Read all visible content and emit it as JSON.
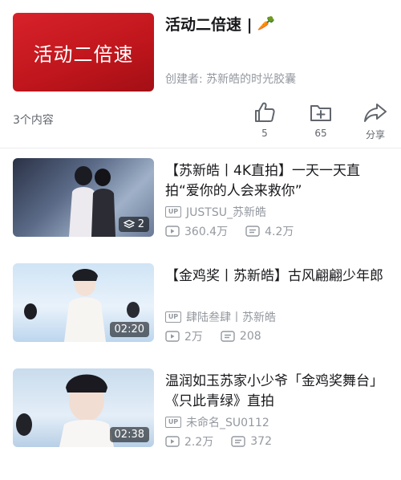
{
  "collection": {
    "cover_text": "活动二倍速",
    "title": "活动二倍速 |",
    "title_emoji": "🥕",
    "creator": "创建者: 苏新皓的时光胶囊",
    "item_count": "3个内容"
  },
  "actions": [
    {
      "label": "5",
      "icon": "thumbs-up-icon"
    },
    {
      "label": "65",
      "icon": "folder-add-icon"
    },
    {
      "label": "分享",
      "icon": "share-icon"
    }
  ],
  "videos": [
    {
      "title": "【苏新皓丨4K直拍】一天一天直拍“爱你的人会来救你”",
      "uploader": "JUSTSU_苏新皓",
      "views": "360.4万",
      "comments": "4.2万",
      "badge": "2",
      "badge_icon": "layers-icon"
    },
    {
      "title": "【金鸡奖丨苏新皓】古风翩翩少年郎",
      "uploader": "肆陆叁肆丨苏新皓",
      "views": "2万",
      "comments": "208",
      "badge": "02:20"
    },
    {
      "title": "温润如玉苏家小少爷「金鸡奖舞台」《只此青绿》直拍",
      "uploader": "未命名_SU0112",
      "views": "2.2万",
      "comments": "372",
      "badge": "02:38"
    }
  ],
  "colors": {
    "accent_red": "#d8222a",
    "meta_gray": "#9499a0",
    "text_dark": "#18191c"
  }
}
